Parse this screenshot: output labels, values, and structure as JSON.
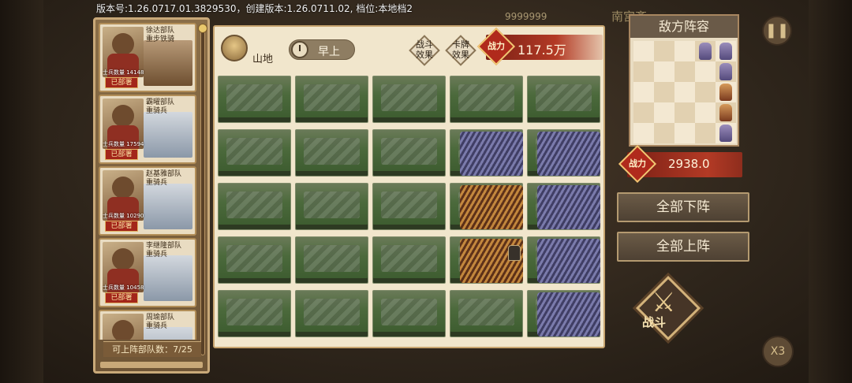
{
  "version_info": "版本号:1.26.0717.01.3829530，创建版本:1.26.0711.02, 档位:本地档2",
  "top_bar": {
    "gold": "9999999",
    "city": "南宫斋"
  },
  "roster": {
    "units": [
      {
        "name_line1": "徐达部队",
        "name_line2": "重步铁骑",
        "count": "士兵数量 14148",
        "tag": "已部署"
      },
      {
        "name_line1": "霸曜部队",
        "name_line2": "重骑兵",
        "count": "士兵数量 17594",
        "tag": "已部署"
      },
      {
        "name_line1": "赵基雅部队",
        "name_line2": "重骑兵",
        "count": "士兵数量 10290",
        "tag": "已部署"
      },
      {
        "name_line1": "李继隆部队",
        "name_line2": "重骑兵",
        "count": "士兵数量 10458",
        "tag": "已部署"
      },
      {
        "name_line1": "周瑜部队",
        "name_line2": "重骑兵",
        "count": "",
        "tag": ""
      }
    ],
    "footer": "可上阵部队数：7/25"
  },
  "board": {
    "terrain": "山地",
    "time_of_day": "早上",
    "battle_effect": "战斗\n效果",
    "card_effect": "卡牌\n效果",
    "power_badge": "战力",
    "power_value": "117.5万"
  },
  "enemy": {
    "title": "敌方阵容",
    "power_badge": "战力",
    "power_value": "2938.0"
  },
  "actions": {
    "withdraw_all": "全部下阵",
    "deploy_all": "全部上阵",
    "battle": "战斗",
    "speed": "X3"
  }
}
